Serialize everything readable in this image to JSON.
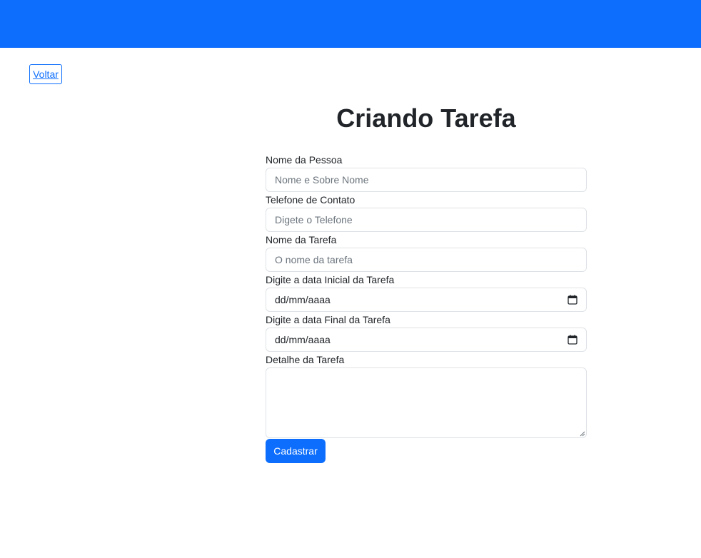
{
  "navbar": {
    "color": "#0d6efd"
  },
  "back_button": {
    "label": "Voltar"
  },
  "page": {
    "title": "Criando Tarefa"
  },
  "form": {
    "fields": [
      {
        "label": "Nome da Pessoa",
        "placeholder": "Nome e Sobre Nome",
        "type": "text"
      },
      {
        "label": "Telefone de Contato",
        "placeholder": "Digete o Telefone",
        "type": "text"
      },
      {
        "label": "Nome da Tarefa",
        "placeholder": "O nome da tarefa",
        "type": "text"
      },
      {
        "label": "Digite a data Inicial da Tarefa",
        "value": "dd/mm/aaaa",
        "type": "date",
        "icon": "calendar-icon"
      },
      {
        "label": "Digite a data Final da Tarefa",
        "value": "dd/mm/aaaa",
        "type": "date",
        "icon": "calendar-icon"
      },
      {
        "label": "Detalhe da Tarefa",
        "value": "",
        "type": "textarea"
      }
    ],
    "submit_label": "Cadastrar"
  },
  "colors": {
    "primary": "#0d6efd",
    "border": "#dee2e6",
    "text": "#212529",
    "placeholder": "#6c757d"
  }
}
